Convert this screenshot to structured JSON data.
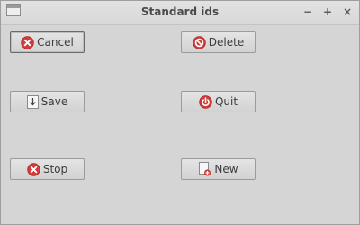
{
  "window": {
    "title": "Standard ids",
    "controls": {
      "minimize": "−",
      "maximize": "+",
      "close": "×"
    }
  },
  "buttons": {
    "cancel": {
      "label": "Cancel",
      "icon": "cancel-icon"
    },
    "delete": {
      "label": "Delete",
      "icon": "delete-icon"
    },
    "save": {
      "label": "Save",
      "icon": "save-icon"
    },
    "quit": {
      "label": "Quit",
      "icon": "power-icon"
    },
    "stop": {
      "label": "Stop",
      "icon": "stop-icon"
    },
    "new": {
      "label": "New",
      "icon": "new-document-icon"
    }
  },
  "colors": {
    "icon_red": "#d23b3b",
    "window_bg": "#d5d5d5"
  }
}
